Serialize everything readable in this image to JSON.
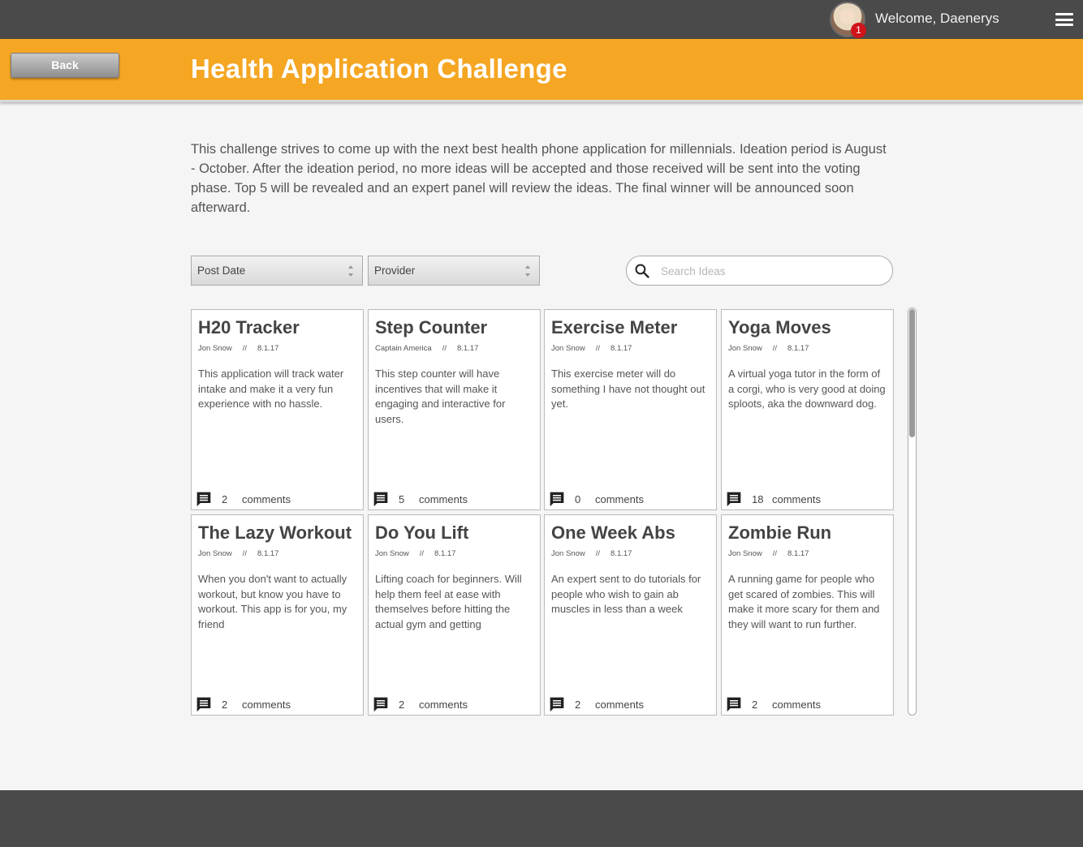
{
  "topbar": {
    "welcome": "Welcome, Daenerys",
    "notification_count": "1"
  },
  "header": {
    "back_label": "Back",
    "title": "Health Application Challenge"
  },
  "description": "This challenge strives to come up with the next best health phone application for millennials. Ideation period is August - October. After the ideation period, no more ideas will be accepted and those received will be sent into the voting phase. Top 5 will be revealed and an expert panel will review the ideas. The final winner will be announced soon afterward.",
  "filters": {
    "sort_value": "Post Date",
    "provider_value": "Provider",
    "search_placeholder": "Search Ideas"
  },
  "comments_label": "comments",
  "meta_separator": "//",
  "ideas": [
    {
      "title": "H20 Tracker",
      "author": "Jon Snow",
      "date": "8.1.17",
      "description": "This application will track water intake and make it a very fun experience with no hassle.",
      "comments": "2"
    },
    {
      "title": "Step Counter",
      "author": "Captain America",
      "date": "8.1.17",
      "description": "This step counter will have incentives that will make it engaging and interactive for users.",
      "comments": "5"
    },
    {
      "title": "Exercise Meter",
      "author": "Jon Snow",
      "date": "8.1.17",
      "description": "This exercise meter will do something I have not thought out yet.",
      "comments": "0"
    },
    {
      "title": "Yoga Moves",
      "author": "Jon Snow",
      "date": "8.1.17",
      "description": "A virtual yoga tutor in the form of a corgi, who is very good at doing sploots, aka the downward dog.",
      "comments": "18"
    },
    {
      "title": "The Lazy Workout",
      "author": "Jon Snow",
      "date": "8.1.17",
      "description": "When you don't want to actually workout, but know you have to workout. This app is for you, my friend",
      "comments": "2"
    },
    {
      "title": "Do You Lift",
      "author": "Jon Snow",
      "date": "8.1.17",
      "description": "Lifting coach for beginners. Will help them feel at ease with themselves before hitting the actual gym and getting",
      "comments": "2"
    },
    {
      "title": "One Week Abs",
      "author": "Jon Snow",
      "date": "8.1.17",
      "description": "An expert sent to do tutorials for people who wish to gain ab muscles in less than a week",
      "comments": "2"
    },
    {
      "title": "Zombie Run",
      "author": "Jon Snow",
      "date": "8.1.17",
      "description": "A running game for people who get scared of zombies. This will make it more scary for them and they will want to run further.",
      "comments": "2"
    }
  ]
}
